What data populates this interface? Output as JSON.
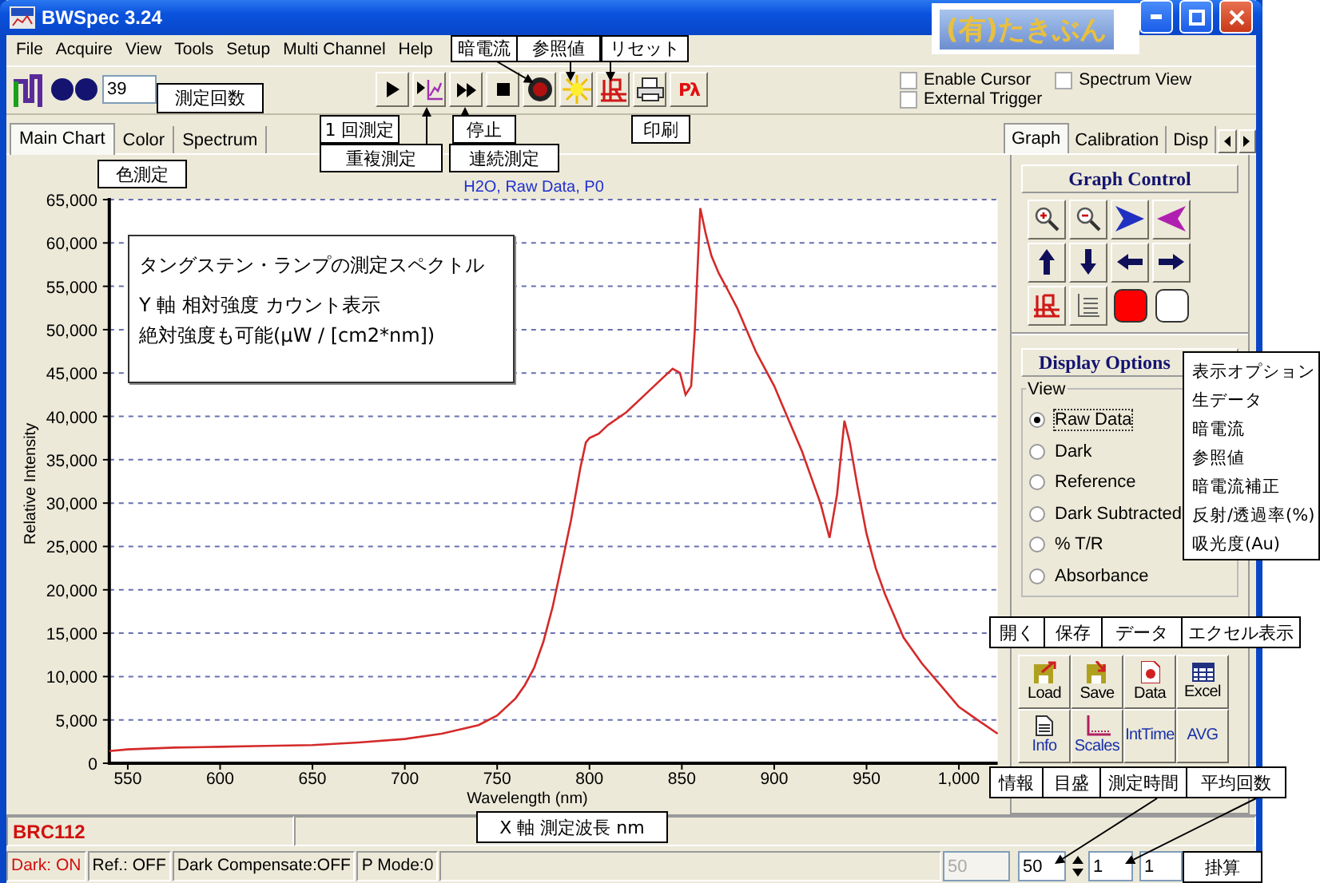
{
  "window": {
    "title": "BWSpec 3.24"
  },
  "logo": {
    "text": "(有)たきぶん"
  },
  "menu": [
    "File",
    "Acquire",
    "View",
    "Tools",
    "Setup",
    "Multi Channel",
    "Help"
  ],
  "toolbar": {
    "scan_count": "39",
    "buttons": [
      {
        "kind": "single"
      },
      {
        "kind": "overlay"
      },
      {
        "kind": "continuous"
      },
      {
        "kind": "stop"
      },
      {
        "kind": "dark"
      },
      {
        "kind": "reference"
      },
      {
        "kind": "reset"
      },
      {
        "kind": "print"
      },
      {
        "kind": "text",
        "label": "Pλ"
      }
    ]
  },
  "options": [
    {
      "label": "Enable Cursor",
      "checked": false
    },
    {
      "label": "Spectrum View",
      "checked": false
    },
    {
      "label": "External Trigger",
      "checked": false
    }
  ],
  "chart_tabs": [
    {
      "label": "Main Chart",
      "selected": true
    },
    {
      "label": "Color",
      "selected": false
    },
    {
      "label": "Spectrum",
      "selected": false
    }
  ],
  "chart": {
    "chart_data": {
      "type": "line",
      "title": "H2O, Raw Data, P0",
      "xlabel": "Wavelength (nm)",
      "ylabel": "Relative Intensity",
      "x": [
        540,
        550,
        575,
        600,
        625,
        650,
        675,
        700,
        720,
        740,
        750,
        760,
        765,
        770,
        775,
        780,
        785,
        790,
        795,
        798,
        800,
        805,
        810,
        820,
        830,
        840,
        845,
        849,
        852,
        855,
        857,
        860,
        863,
        866,
        870,
        875,
        880,
        885,
        890,
        895,
        900,
        905,
        910,
        915,
        920,
        925,
        930,
        934,
        938,
        941,
        945,
        950,
        955,
        960,
        970,
        980,
        990,
        1000,
        1010,
        1021
      ],
      "grid": true,
      "series": [
        {
          "color": "#d42a2a",
          "values": [
            1400,
            1600,
            1800,
            1900,
            2000,
            2100,
            2400,
            2800,
            3400,
            4400,
            5500,
            7500,
            9000,
            11000,
            14000,
            18000,
            23000,
            28000,
            34000,
            37000,
            37500,
            38000,
            39000,
            40500,
            42500,
            44500,
            45500,
            45000,
            42500,
            43500,
            50000,
            64000,
            61000,
            58500,
            56500,
            54500,
            52500,
            50000,
            47500,
            45500,
            43500,
            41000,
            38500,
            36000,
            33000,
            30000,
            26000,
            31000,
            39500,
            37000,
            32000,
            26500,
            22500,
            19500,
            14500,
            11500,
            9000,
            6500,
            5000,
            3400
          ]
        }
      ],
      "xlim": [
        540,
        1021
      ],
      "ylim": [
        0,
        65000
      ],
      "xticks": [
        550,
        600,
        650,
        700,
        750,
        800,
        850,
        900,
        950,
        {
          "value": 1000,
          "label": "1,000"
        }
      ],
      "yticks": [
        0,
        {
          "value": 5000,
          "label": "5,000"
        },
        {
          "value": 10000,
          "label": "10,000"
        },
        {
          "value": 15000,
          "label": "15,000"
        },
        {
          "value": 20000,
          "label": "20,000"
        },
        {
          "value": 25000,
          "label": "25,000"
        },
        {
          "value": 30000,
          "label": "30,000"
        },
        {
          "value": 35000,
          "label": "35,000"
        },
        {
          "value": 40000,
          "label": "40,000"
        },
        {
          "value": 45000,
          "label": "45,000"
        },
        {
          "value": 50000,
          "label": "50,000"
        },
        {
          "value": 55000,
          "label": "55,000"
        },
        {
          "value": 60000,
          "label": "60,000"
        },
        {
          "value": 65000,
          "label": "65,000"
        }
      ]
    }
  },
  "side_tabs": [
    {
      "label": "Graph",
      "selected": true
    },
    {
      "label": "Calibration",
      "selected": false
    },
    {
      "label": "Disp",
      "selected": false
    }
  ],
  "graph_control": {
    "title": "Graph Control",
    "buttons": [
      {
        "kind": "zoom-in"
      },
      {
        "kind": "zoom-out"
      },
      {
        "kind": "stretch"
      },
      {
        "kind": "shrink"
      },
      {
        "kind": "up"
      },
      {
        "kind": "down"
      },
      {
        "kind": "left"
      },
      {
        "kind": "right"
      },
      {
        "kind": "reset"
      },
      {
        "kind": "grid"
      },
      {
        "kind": "swatch",
        "color": "#ff0000"
      },
      {
        "kind": "swatch",
        "color": "#ffffff"
      }
    ]
  },
  "display_options": {
    "title": "Display Options",
    "group": "View",
    "options": [
      {
        "label": "Raw Data",
        "selected": true
      },
      {
        "label": "Dark",
        "selected": false
      },
      {
        "label": "Reference",
        "selected": false
      },
      {
        "label": "Dark Subtracted",
        "selected": false
      },
      {
        "label": "% T/R",
        "selected": false
      },
      {
        "label": "Absorbance",
        "selected": false
      }
    ]
  },
  "file_buttons": [
    {
      "label": "Load",
      "kind": "load"
    },
    {
      "label": "Save",
      "kind": "save"
    },
    {
      "label": "Data",
      "kind": "data"
    },
    {
      "label": "Excel",
      "kind": "excel"
    }
  ],
  "tool_buttons": [
    {
      "label": "Info",
      "kind": "info"
    },
    {
      "label": "Scales",
      "kind": "scales"
    },
    {
      "label": "IntTime",
      "kind": "text"
    },
    {
      "label": "AVG",
      "kind": "text"
    }
  ],
  "device": "BRC112",
  "status_bar": [
    {
      "text": "Dark: ON",
      "kind": "alert"
    },
    {
      "text": "Ref.: OFF",
      "kind": "plain"
    },
    {
      "text": "Dark Compensate:OFF",
      "kind": "plain"
    },
    {
      "text": "P Mode:0",
      "kind": "plain"
    }
  ],
  "fields": [
    {
      "value": "50",
      "disabled": true,
      "kind": "plain"
    },
    {
      "value": "50",
      "disabled": false,
      "kind": "spinner"
    },
    {
      "value": "1",
      "disabled": false,
      "kind": "plain"
    },
    {
      "value": "1",
      "disabled": false,
      "kind": "plain"
    }
  ],
  "callouts": [
    "暗電流",
    "参照値",
    "リセット",
    "測定回数",
    "1 回測定",
    "停止",
    "印刷",
    "重複測定",
    "連続測定",
    "色測定",
    "X 軸  測定波長  nm",
    "掛算"
  ],
  "note": {
    "title": "タングステン・ランプの測定スペクトル",
    "lines": [
      "Y 軸  相対強度  カウント表示",
      "絶対強度も可能(μW / [cm2*nm])"
    ]
  },
  "options_legend": [
    "表示オプション",
    "生データ",
    "暗電流",
    "参照値",
    "暗電流補正",
    "反射/透過率(%)",
    "吸光度(Au)"
  ],
  "button_legend": [
    "開く",
    "保存",
    "データ",
    "エクセル表示"
  ],
  "field_legend": [
    "情報",
    "目盛",
    "測定時間",
    "平均回数"
  ]
}
